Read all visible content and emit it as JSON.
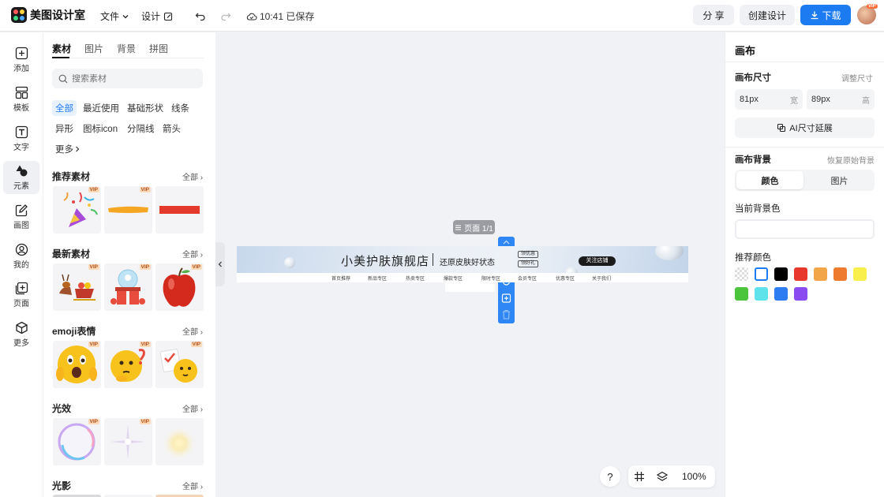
{
  "app": {
    "name": "美图设计室",
    "menu_file": "文件",
    "menu_design": "设计",
    "saved_status": "10:41 已保存",
    "share": "分 享",
    "create": "创建设计",
    "download": "下载",
    "avatar_badge": "VIP"
  },
  "rail": {
    "items": [
      {
        "label": "添加",
        "icon": "plus-square-icon"
      },
      {
        "label": "模板",
        "icon": "template-icon"
      },
      {
        "label": "文字",
        "icon": "text-icon"
      },
      {
        "label": "元素",
        "icon": "shapes-icon"
      },
      {
        "label": "画图",
        "icon": "pencil-icon"
      },
      {
        "label": "我的",
        "icon": "user-icon"
      },
      {
        "label": "页面",
        "icon": "page-add-icon"
      },
      {
        "label": "更多",
        "icon": "cube-icon"
      }
    ]
  },
  "panel": {
    "tabs": [
      "素材",
      "图片",
      "背景",
      "拼图"
    ],
    "search_placeholder": "搜索素材",
    "chips": [
      "全部",
      "最近使用",
      "基础形状",
      "线条",
      "异形",
      "图标icon",
      "分隔线",
      "箭头",
      "更多"
    ],
    "sections": [
      {
        "title": "推荐素材",
        "all": "全部"
      },
      {
        "title": "最新素材",
        "all": "全部"
      },
      {
        "title": "emoji表情",
        "all": "全部"
      },
      {
        "title": "光效",
        "all": "全部"
      },
      {
        "title": "光影",
        "all": "全部"
      }
    ],
    "vip_label": "VIP"
  },
  "canvas": {
    "page_tag": "页面 1/1",
    "shop_name": "小美护肤旗舰店",
    "slogan": "还原皮肤好状态",
    "coupon_1": "领优惠",
    "coupon_2": "领好礼",
    "follow": "关注店铺",
    "nav": [
      "首页推荐",
      "新品专区",
      "热卖专区",
      "爆款专区",
      "限时专区",
      "会员专区",
      "优惠专区",
      "关于我们"
    ],
    "zoom": "100%",
    "help": "?"
  },
  "right": {
    "title": "画布",
    "size_label": "画布尺寸",
    "size_adjust": "调整尺寸",
    "width_value": "81px",
    "width_unit": "宽",
    "height_value": "89px",
    "height_unit": "高",
    "ai_extend": "AI尺寸延展",
    "bg_label": "画布背景",
    "bg_reset": "恢复原始背景",
    "tab_color": "颜色",
    "tab_image": "图片",
    "current_bg": "当前背景色",
    "recommend": "推荐颜色",
    "swatches": [
      "transparent",
      "#ffffff",
      "#000000",
      "#e8382d",
      "#f3a54a",
      "#ee7a30",
      "#f9ef4c",
      "#4cc53c",
      "#5ee3ea",
      "#2e7cf1",
      "#8a4cf0"
    ]
  }
}
